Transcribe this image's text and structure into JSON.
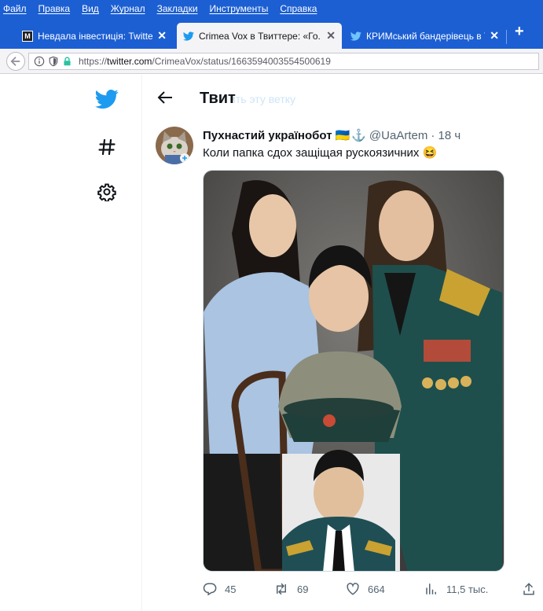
{
  "menubar": [
    "Файл",
    "Правка",
    "Вид",
    "Журнал",
    "Закладки",
    "Инструменты",
    "Справка"
  ],
  "tabs": [
    {
      "label": "Невдала інвестиція: Twitter ...",
      "icon": "m-favicon-icon",
      "active": false
    },
    {
      "label": "Crimea Vox в Твиттере: «Го...",
      "icon": "twitter-favicon-icon",
      "active": true
    },
    {
      "label": "КРИМський бандерівець в Т...",
      "icon": "twitter-favicon-icon",
      "active": false
    }
  ],
  "tab_close": "✕",
  "new_tab": "+",
  "url": {
    "prefix": "https://",
    "domain": "twitter.com",
    "path": "/CrimeaVox/status/1663594003554500619"
  },
  "header": {
    "title": "Твит",
    "ghost": "ить эту ветку"
  },
  "tweet": {
    "author": "Пухнастий українобот",
    "handle": "@UaArtem",
    "time": "· 18 ч",
    "text": "Коли папка сдох защіщая рускоязичних 😆",
    "flag_emoji": "🇺🇦",
    "anchor_emoji": "⚓"
  },
  "actions": {
    "replies": "45",
    "retweets": "69",
    "likes": "664",
    "views": "11,5 тыс."
  },
  "colors": {
    "firefox_blue": "#1c5fd3",
    "twitter_blue": "#1d9bf0",
    "text": "#0f1419",
    "muted": "#536471"
  }
}
